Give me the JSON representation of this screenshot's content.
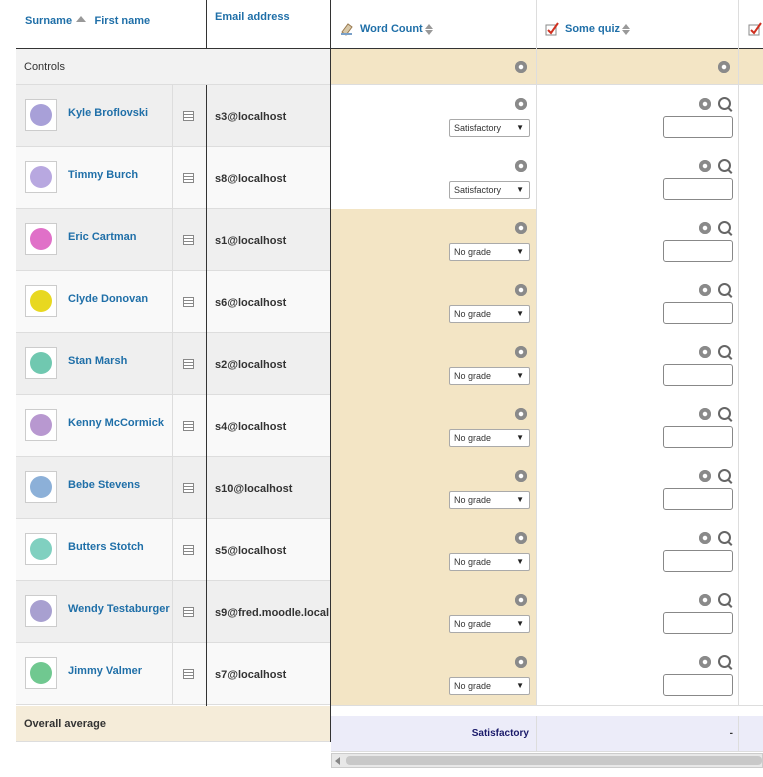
{
  "header": {
    "surname_label": "Surname",
    "firstname_label": "First name",
    "email_label": "Email address",
    "columns": [
      {
        "label": "Word Count"
      },
      {
        "label": "Some quiz"
      }
    ]
  },
  "controls_label": "Controls",
  "students": [
    {
      "name": "Kyle Broflovski",
      "email": "s3@localhost",
      "grade": "Satisfactory",
      "avatar_color": "#a8a0d8"
    },
    {
      "name": "Timmy Burch",
      "email": "s8@localhost",
      "grade": "Satisfactory",
      "avatar_color": "#b8a8e0"
    },
    {
      "name": "Eric Cartman",
      "email": "s1@localhost",
      "grade": "No grade",
      "avatar_color": "#e070c8"
    },
    {
      "name": "Clyde Donovan",
      "email": "s6@localhost",
      "grade": "No grade",
      "avatar_color": "#e8d820"
    },
    {
      "name": "Stan Marsh",
      "email": "s2@localhost",
      "grade": "No grade",
      "avatar_color": "#70c8b0"
    },
    {
      "name": "Kenny McCormick",
      "email": "s4@localhost",
      "grade": "No grade",
      "avatar_color": "#b898d0"
    },
    {
      "name": "Bebe Stevens",
      "email": "s10@localhost",
      "grade": "No grade",
      "avatar_color": "#8cb0d8"
    },
    {
      "name": "Butters Stotch",
      "email": "s5@localhost",
      "grade": "No grade",
      "avatar_color": "#80d0c0"
    },
    {
      "name": "Wendy Testaburger",
      "email": "s9@fred.moodle.local",
      "grade": "No grade",
      "avatar_color": "#a8a0d0"
    },
    {
      "name": "Jimmy Valmer",
      "email": "s7@localhost",
      "grade": "No grade",
      "avatar_color": "#70c890"
    }
  ],
  "overall_average": {
    "label": "Overall average",
    "word_count": "Satisfactory",
    "some_quiz": "-"
  },
  "colors": {
    "link": "#1f6fa8",
    "highlight": "#f3e5c5",
    "average_row": "#ececf9"
  }
}
